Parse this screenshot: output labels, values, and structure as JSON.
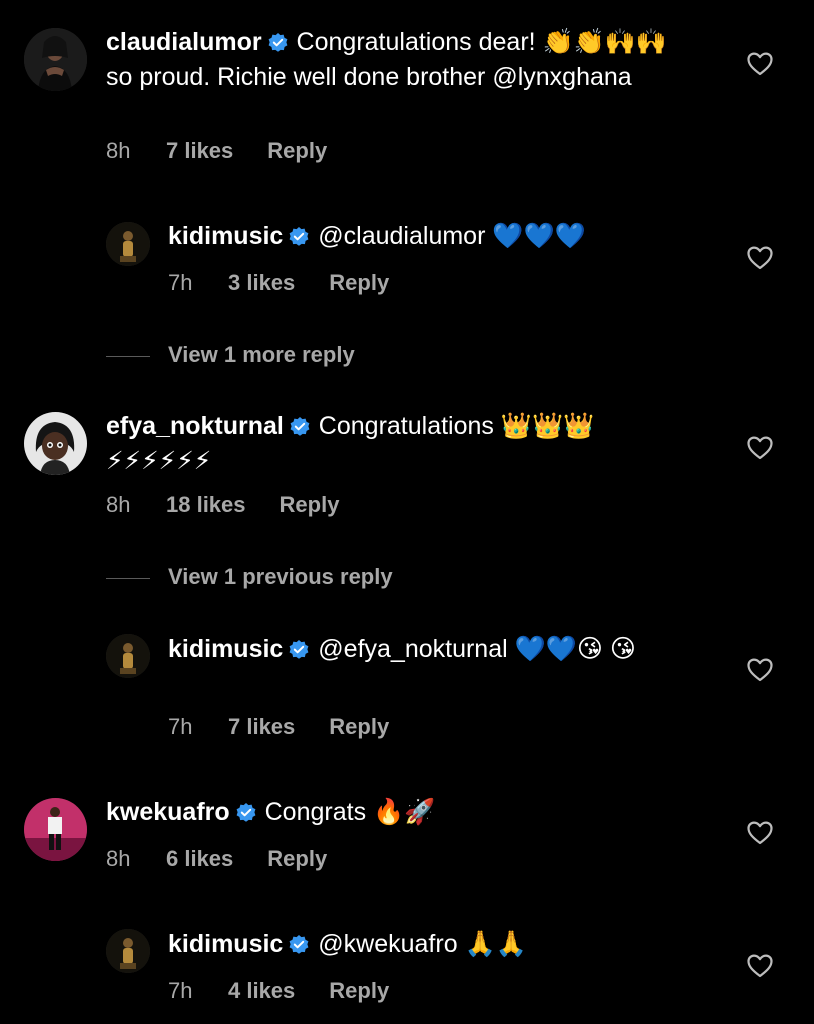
{
  "comments": [
    {
      "username": "claudialumor",
      "text": "Congratulations dear! 👏👏🙌🙌 so proud. Richie well done brother @lynxghana",
      "time": "8h",
      "likes": "7 likes",
      "reply": "Reply"
    },
    {
      "username": "kidimusic",
      "text": "@claudialumor 💙💙💙",
      "time": "7h",
      "likes": "3 likes",
      "reply": "Reply"
    },
    {
      "username": "efya_nokturnal",
      "text": "Congratulations 👑👑👑 ⚡⚡⚡⚡⚡⚡",
      "time": "8h",
      "likes": "18 likes",
      "reply": "Reply"
    },
    {
      "username": "kidimusic",
      "text": "@efya_nokturnal 💙💙😘 😘",
      "time": "7h",
      "likes": "7 likes",
      "reply": "Reply"
    },
    {
      "username": "kwekuafro",
      "text": "Congrats 🔥🚀",
      "time": "8h",
      "likes": "6 likes",
      "reply": "Reply"
    },
    {
      "username": "kidimusic",
      "text": "@kwekuafro 🙏🙏",
      "time": "7h",
      "likes": "4 likes",
      "reply": "Reply"
    }
  ],
  "view_more": [
    {
      "text": "View 1 more reply"
    },
    {
      "text": "View 1 previous reply"
    }
  ],
  "colors": {
    "background": "#000000",
    "verified": "#3897f0",
    "meta": "#a8a8a8"
  },
  "icons": [
    "verified-badge-icon",
    "heart-icon"
  ]
}
